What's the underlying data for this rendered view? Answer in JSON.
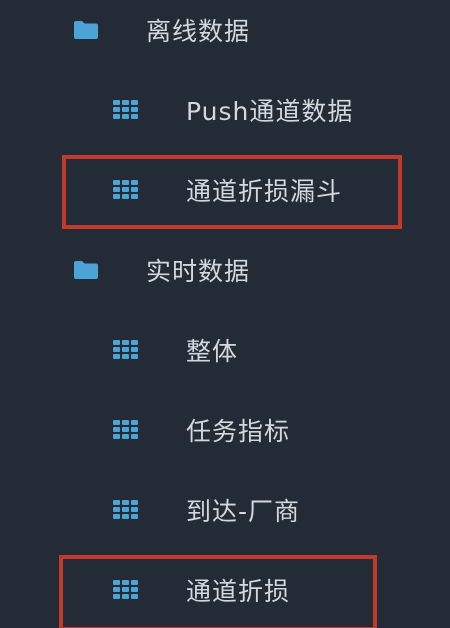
{
  "colors": {
    "background": "#222b36",
    "text": "#d2d8de",
    "icon": "#4ca3d6",
    "highlight": "#c0392b"
  },
  "menu": [
    {
      "type": "folder",
      "icon": "folder-icon",
      "label": "离线数据"
    },
    {
      "type": "item",
      "icon": "grid-icon",
      "label": "Push通道数据"
    },
    {
      "type": "item",
      "icon": "grid-icon",
      "label": "通道折损漏斗",
      "highlighted": true
    },
    {
      "type": "folder",
      "icon": "folder-icon",
      "label": "实时数据"
    },
    {
      "type": "item",
      "icon": "grid-icon",
      "label": "整体"
    },
    {
      "type": "item",
      "icon": "grid-icon",
      "label": "任务指标"
    },
    {
      "type": "item",
      "icon": "grid-icon",
      "label": "到达-厂商"
    },
    {
      "type": "item",
      "icon": "grid-icon",
      "label": "通道折损",
      "highlighted": true
    }
  ]
}
